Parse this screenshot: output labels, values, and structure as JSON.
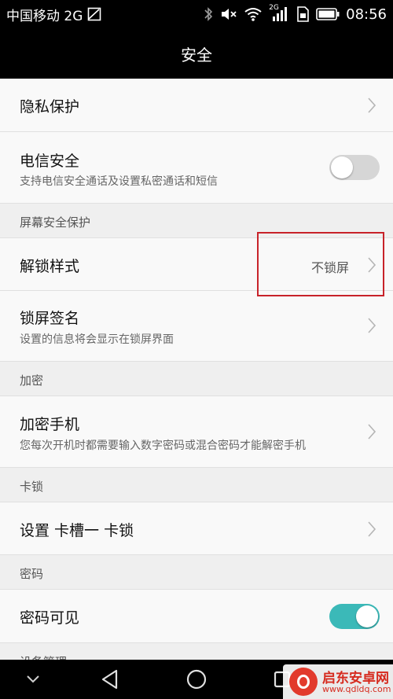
{
  "status_bar": {
    "carrier": "中国移动 2G",
    "network_badge": "2G",
    "time": "08:56",
    "icons": [
      "image-icon",
      "bluetooth-icon",
      "mute-icon",
      "wifi-icon",
      "signal-icon",
      "sim-icon",
      "battery-icon"
    ]
  },
  "app_bar": {
    "title": "安全"
  },
  "rows": {
    "privacy": {
      "title": "隐私保护"
    },
    "telecom": {
      "title": "电信安全",
      "subtitle": "支持电信安全通话及设置私密通话和短信",
      "enabled": false
    },
    "unlock_style": {
      "title": "解锁样式",
      "value": "不锁屏"
    },
    "lock_signature": {
      "title": "锁屏签名",
      "subtitle": "设置的信息将会显示在锁屏界面"
    },
    "encrypt_phone": {
      "title": "加密手机",
      "subtitle": "您每次开机时都需要输入数字密码或混合密码才能解密手机"
    },
    "sim1_lock": {
      "title": "设置 卡槽一 卡锁"
    },
    "password_visible": {
      "title": "密码可见",
      "enabled": true
    }
  },
  "sections": {
    "screen_security": "屏幕安全保护",
    "encryption": "加密",
    "sim_lock": "卡锁",
    "password": "密码",
    "device_admin": "设备管理"
  },
  "colors": {
    "toggle_on": "#3bb9b8",
    "toggle_off": "#d6d6d6",
    "highlight": "#c8232a",
    "watermark": "#d62b1f"
  },
  "watermark": {
    "title": "启东安卓网",
    "url": "www.qdldq.com"
  }
}
